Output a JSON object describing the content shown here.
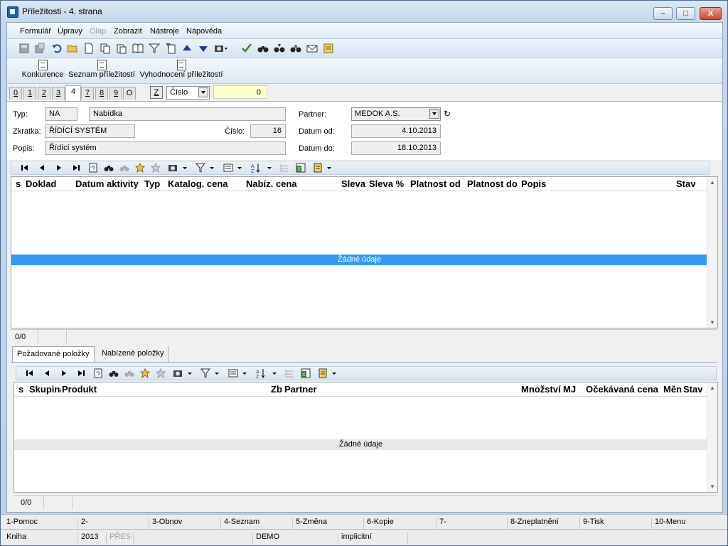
{
  "window": {
    "title": "Příležitosti - 4. strana",
    "min": "–",
    "max": "□",
    "close": "X"
  },
  "menu": [
    "Formulář",
    "Úpravy",
    "Olap",
    "Zobrazit",
    "Nástroje",
    "Nápověda"
  ],
  "quick_buttons": [
    "Konkurence",
    "Seznam příležitostí",
    "Vyhodnocení příležitostí"
  ],
  "page_tabs": [
    "0",
    "1",
    "2",
    "3",
    "4",
    "7",
    "8",
    "9",
    "O"
  ],
  "active_tab": "4",
  "sort": {
    "z_label": "Z",
    "field": "Číslo",
    "value": "0"
  },
  "form": {
    "typ_label": "Typ:",
    "typ_code": "NA",
    "typ_name": "Nabídka",
    "zkratka_label": "Zkratka:",
    "zkratka": "ŘÍDÍCÍ SYSTÉM",
    "cislo_label": "Číslo:",
    "cislo": "16",
    "popis_label": "Popis:",
    "popis": "Řídící systém",
    "partner_label": "Partner:",
    "partner": "MEDOK A.S.",
    "datum_od_label": "Datum od:",
    "datum_od": "4.10.2013",
    "datum_do_label": "Datum do:",
    "datum_do": "18.10.2013"
  },
  "grid1": {
    "columns": [
      "s",
      "Doklad",
      "Datum aktivity",
      "Typ",
      "Katalog. cena",
      "Nabíz. cena",
      "Sleva",
      "Sleva %",
      "Platnost od",
      "Platnost do",
      "Popis",
      "Stav"
    ],
    "empty_text": "Žádné údaje",
    "count": "0/0"
  },
  "subtabs": [
    "Požadované položky",
    "Nabízené položky"
  ],
  "grid2": {
    "columns": [
      "s",
      "Skupina",
      "Produkt",
      "Zb",
      "Partner",
      "Množství",
      "MJ",
      "Očekávaná cena",
      "Měn",
      "Stav"
    ],
    "empty_text": "Žádné údaje",
    "count": "0/0"
  },
  "fkeys": [
    "1-Pomoc",
    "2-",
    "3-Obnov",
    "4-Seznam",
    "5-Změna",
    "6-Kopie",
    "7-",
    "8-Zneplatnění",
    "9-Tisk",
    "10-Menu"
  ],
  "statusbar": {
    "module": "Kniha",
    "year": "2013",
    "mode": "PŘES",
    "db": "DEMO",
    "profile": "implicitní"
  },
  "colors": {
    "selection": "#3399ff",
    "field_bg": "#efefef",
    "highlight_input": "#ffffcc"
  }
}
